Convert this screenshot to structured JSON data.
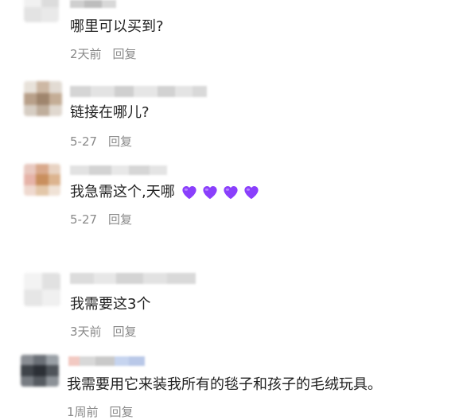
{
  "comments": [
    {
      "text": "哪里可以买到?",
      "time": "2天前",
      "reply_label": "回复"
    },
    {
      "text": "链接在哪儿?",
      "time": "5-27",
      "reply_label": "回复"
    },
    {
      "text": "我急需这个,天哪",
      "emoji_count": 4,
      "emoji": "purple-heart-icon",
      "emoji_color": "#8a3ffc",
      "time": "5-27",
      "reply_label": "回复"
    },
    {
      "text": "我需要这3个",
      "time": "3天前",
      "reply_label": "回复"
    },
    {
      "text": "我需要用它来装我所有的毯子和孩子的毛绒玩具。",
      "time": "1周前",
      "reply_label": "回复"
    }
  ]
}
